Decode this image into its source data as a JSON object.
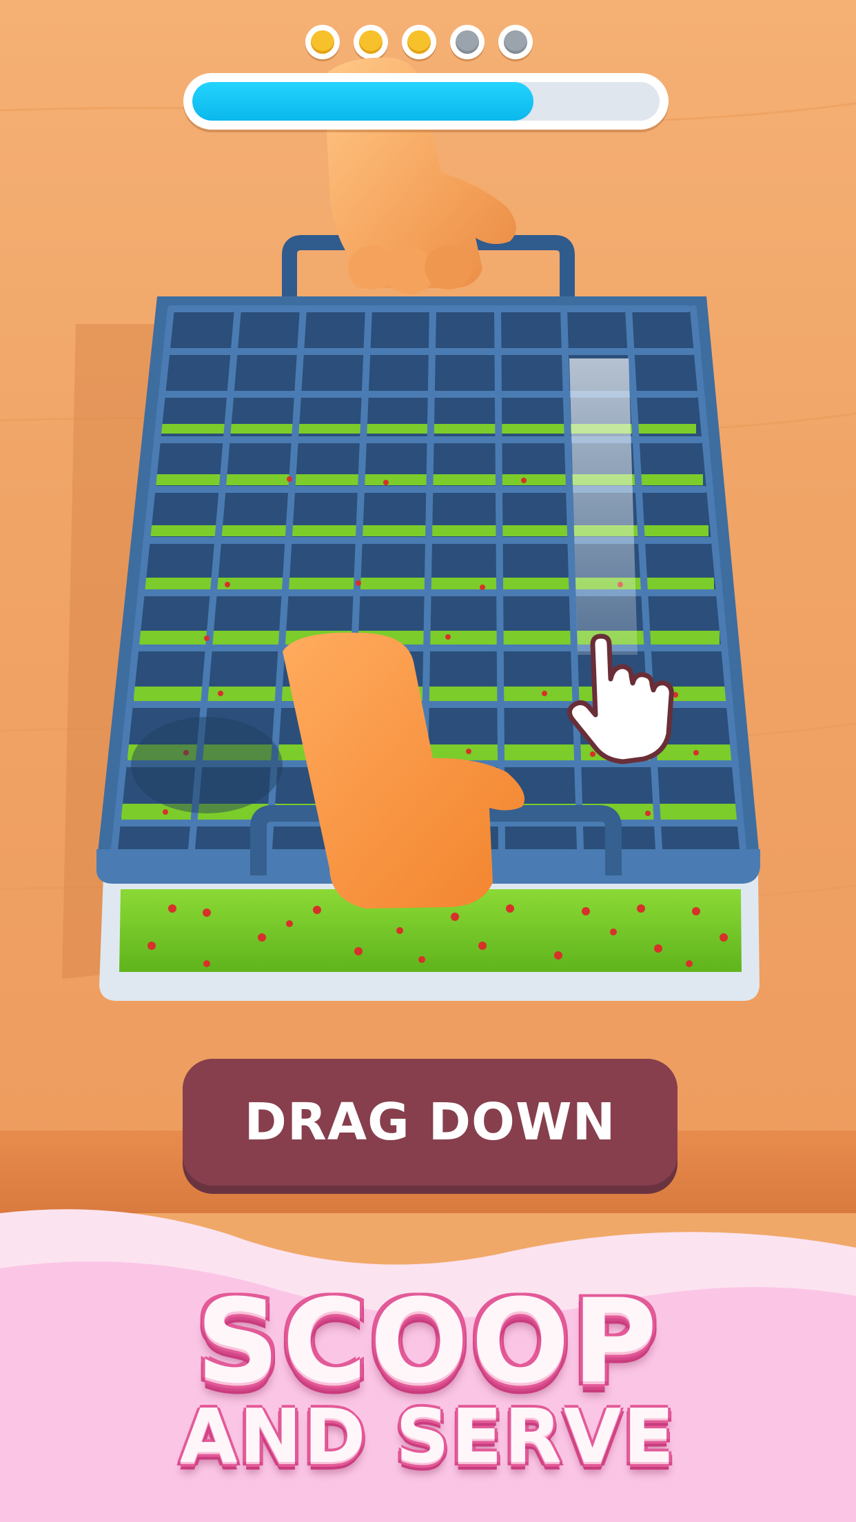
{
  "level_dots": [
    {
      "state": "filled"
    },
    {
      "state": "filled"
    },
    {
      "state": "filled"
    },
    {
      "state": "empty"
    },
    {
      "state": "empty"
    }
  ],
  "progress": {
    "fraction": 0.73
  },
  "tutorial": {
    "instruction": "DRAG DOWN",
    "gesture_icon": "pointing-hand-icon"
  },
  "banner": {
    "line1": "SCOOP",
    "line2": "AND SERVE"
  },
  "colors": {
    "progress_fill": "#0ab8ec",
    "button": "#873f4d",
    "grid": "#3e6da0",
    "filling": "#7ccc2b",
    "title_outline": "#e35a98"
  }
}
